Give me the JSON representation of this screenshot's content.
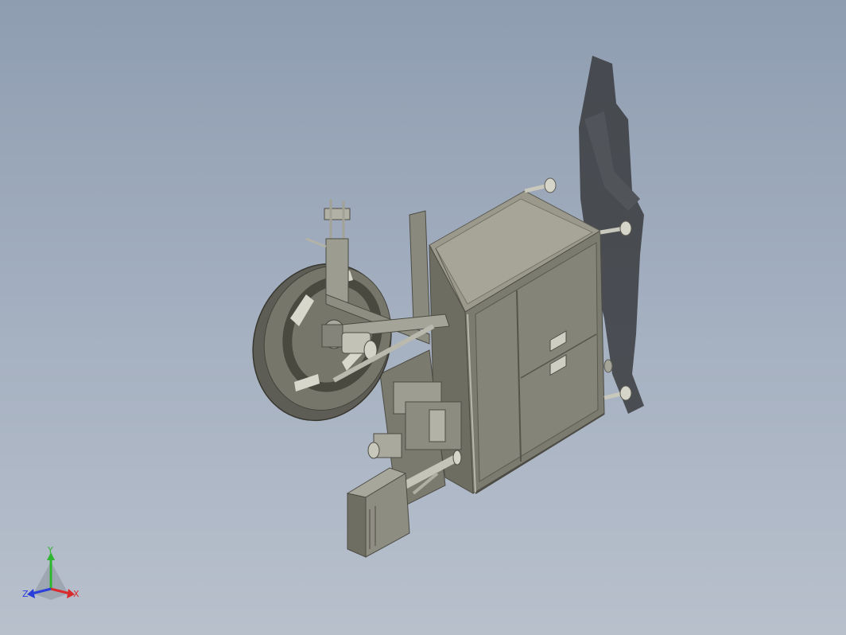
{
  "viewport": {
    "background_top": "#8f9db1",
    "background_bottom": "#b8c0cc",
    "model": "labeling-machine-assembly"
  },
  "triad": {
    "x_label": "X",
    "y_label": "Y",
    "z_label": "Z",
    "x_color": "#d92b2b",
    "y_color": "#2fb52f",
    "z_color": "#2b3fd9"
  }
}
